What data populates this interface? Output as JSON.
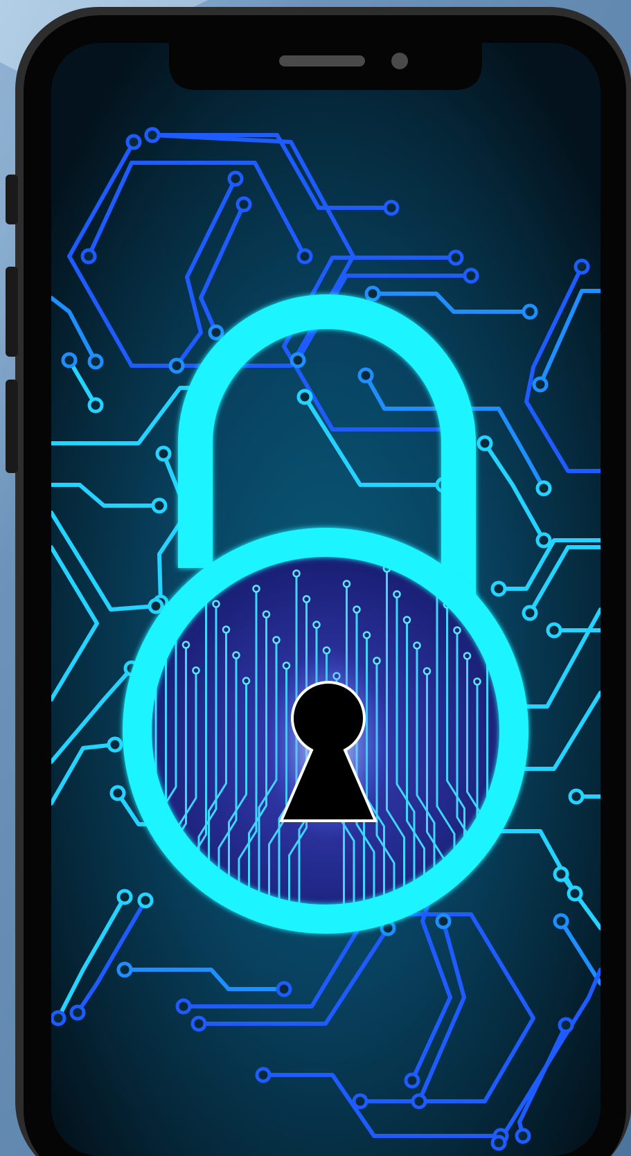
{
  "colors": {
    "backdrop": "#5b82a8",
    "backdrop_light": "#9ec0de",
    "phone_frame": "#0a0a0a",
    "phone_bezel": "#2b2b2b",
    "screen_top": "#051722",
    "screen_mid": "#0a4a66",
    "circuit_blue": "#1f5cff",
    "circuit_mid": "#1f8fff",
    "circuit_cyan": "#24d3ff",
    "padlock_cyan": "#1ef4ff",
    "lock_face": "#151b6a",
    "lock_face_glow": "#3a3fb8",
    "keyhole": "#000000",
    "keyhole_glow": "#ffffff"
  },
  "icons": {
    "padlock": "padlock-icon",
    "keyhole": "keyhole-icon",
    "speaker": "speaker-grille",
    "camera": "front-camera"
  }
}
